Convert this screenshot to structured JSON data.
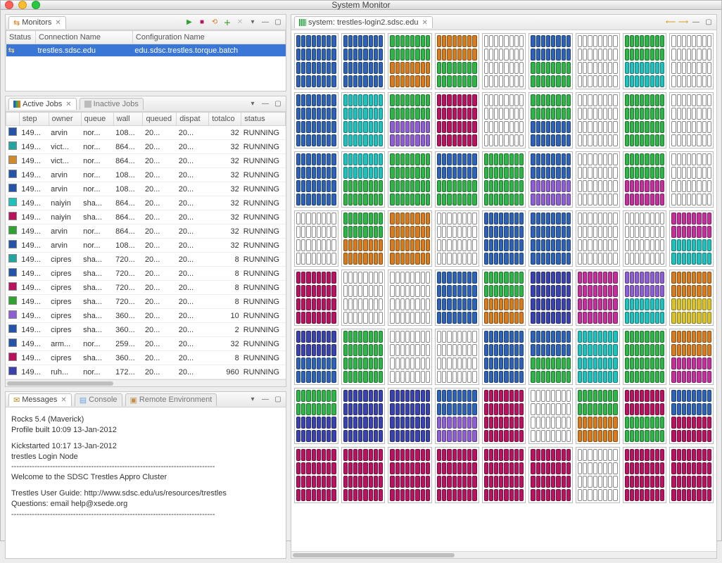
{
  "window": {
    "title": "System Monitor"
  },
  "toolbar_icons": {
    "play": "▶",
    "stop": "■",
    "refresh": "⟲",
    "add": "＋",
    "remove": "✕",
    "menu": "▾",
    "min": "—",
    "max": "▢",
    "left": "⟵",
    "right": "⟶"
  },
  "monitors": {
    "tab_label": "Monitors",
    "columns": [
      "Status",
      "Connection Name",
      "Configuration Name"
    ],
    "row": {
      "status": "",
      "connection": "trestles.sdsc.edu",
      "config": "edu.sdsc.trestles.torque.batch"
    }
  },
  "jobs": {
    "active_tab": "Active Jobs",
    "inactive_tab": "Inactive Jobs",
    "columns": [
      "",
      "step",
      "owner",
      "queue",
      "wall",
      "queued",
      "dispat",
      "totalco",
      "status"
    ],
    "rows": [
      {
        "c": "#2255aa",
        "step": "149...",
        "owner": "arvin",
        "queue": "nor...",
        "wall": "108...",
        "queued": "20...",
        "dispat": "20...",
        "total": "32",
        "status": "RUNNING"
      },
      {
        "c": "#1fa6a0",
        "step": "149...",
        "owner": "vict...",
        "queue": "nor...",
        "wall": "864...",
        "queued": "20...",
        "dispat": "20...",
        "total": "32",
        "status": "RUNNING"
      },
      {
        "c": "#d08a2a",
        "step": "149...",
        "owner": "vict...",
        "queue": "nor...",
        "wall": "864...",
        "queued": "20...",
        "dispat": "20...",
        "total": "32",
        "status": "RUNNING"
      },
      {
        "c": "#2255aa",
        "step": "149...",
        "owner": "arvin",
        "queue": "nor...",
        "wall": "108...",
        "queued": "20...",
        "dispat": "20...",
        "total": "32",
        "status": "RUNNING"
      },
      {
        "c": "#2255aa",
        "step": "149...",
        "owner": "arvin",
        "queue": "nor...",
        "wall": "108...",
        "queued": "20...",
        "dispat": "20...",
        "total": "32",
        "status": "RUNNING"
      },
      {
        "c": "#1fc1bd",
        "step": "149...",
        "owner": "naiyin",
        "queue": "sha...",
        "wall": "864...",
        "queued": "20...",
        "dispat": "20...",
        "total": "32",
        "status": "RUNNING"
      },
      {
        "c": "#b9135f",
        "step": "149...",
        "owner": "naiyin",
        "queue": "sha...",
        "wall": "864...",
        "queued": "20...",
        "dispat": "20...",
        "total": "32",
        "status": "RUNNING"
      },
      {
        "c": "#2fa22f",
        "step": "149...",
        "owner": "arvin",
        "queue": "nor...",
        "wall": "864...",
        "queued": "20...",
        "dispat": "20...",
        "total": "32",
        "status": "RUNNING"
      },
      {
        "c": "#2255aa",
        "step": "149...",
        "owner": "arvin",
        "queue": "nor...",
        "wall": "108...",
        "queued": "20...",
        "dispat": "20...",
        "total": "32",
        "status": "RUNNING"
      },
      {
        "c": "#1fa6a0",
        "step": "149...",
        "owner": "cipres",
        "queue": "sha...",
        "wall": "720...",
        "queued": "20...",
        "dispat": "20...",
        "total": "8",
        "status": "RUNNING"
      },
      {
        "c": "#2255aa",
        "step": "149...",
        "owner": "cipres",
        "queue": "sha...",
        "wall": "720...",
        "queued": "20...",
        "dispat": "20...",
        "total": "8",
        "status": "RUNNING"
      },
      {
        "c": "#b9135f",
        "step": "149...",
        "owner": "cipres",
        "queue": "sha...",
        "wall": "720...",
        "queued": "20...",
        "dispat": "20...",
        "total": "8",
        "status": "RUNNING"
      },
      {
        "c": "#2fa22f",
        "step": "149...",
        "owner": "cipres",
        "queue": "sha...",
        "wall": "720...",
        "queued": "20...",
        "dispat": "20...",
        "total": "8",
        "status": "RUNNING"
      },
      {
        "c": "#8e5fd4",
        "step": "149...",
        "owner": "cipres",
        "queue": "sha...",
        "wall": "360...",
        "queued": "20...",
        "dispat": "20...",
        "total": "10",
        "status": "RUNNING"
      },
      {
        "c": "#2255aa",
        "step": "149...",
        "owner": "cipres",
        "queue": "sha...",
        "wall": "360...",
        "queued": "20...",
        "dispat": "20...",
        "total": "2",
        "status": "RUNNING"
      },
      {
        "c": "#2255aa",
        "step": "149...",
        "owner": "arm...",
        "queue": "nor...",
        "wall": "259...",
        "queued": "20...",
        "dispat": "20...",
        "total": "32",
        "status": "RUNNING"
      },
      {
        "c": "#b9135f",
        "step": "149...",
        "owner": "cipres",
        "queue": "sha...",
        "wall": "360...",
        "queued": "20...",
        "dispat": "20...",
        "total": "8",
        "status": "RUNNING"
      },
      {
        "c": "#3a42b0",
        "step": "149...",
        "owner": "ruh...",
        "queue": "nor...",
        "wall": "172...",
        "queued": "20...",
        "dispat": "20...",
        "total": "960",
        "status": "RUNNING"
      }
    ]
  },
  "messages": {
    "tab_messages": "Messages",
    "tab_console": "Console",
    "tab_remote": "Remote Environment",
    "lines": {
      "l1": "Rocks 5.4 (Maverick)",
      "l2": "Profile built 10:09 13-Jan-2012",
      "l3": "Kickstarted 10:17 13-Jan-2012",
      "l4": "trestles Login Node",
      "dash": "-------------------------------------------------------------------------------",
      "l5": "Welcome to the SDSC Trestles Appro Cluster",
      "l6": "Trestles User Guide: http://www.sdsc.edu/us/resources/trestles",
      "l7": "Questions: email help@xsede.org"
    }
  },
  "system": {
    "tab_label": "system: trestles-login2.sdsc.edu",
    "palette": {
      "blue": "#2e62b8",
      "green": "#2fb447",
      "orange": "#d87a1e",
      "teal": "#1fc1bd",
      "purple": "#8e5fd4",
      "pink": "#c42f9c",
      "crimson": "#b9135f",
      "navy": "#3a42b0",
      "yellow": "#d9c12a",
      "white": "#ffffff"
    },
    "grid": [
      [
        "blue",
        "blue",
        "green/orange",
        "orange/green",
        "white",
        "blue/green",
        "white",
        "green/teal",
        "white"
      ],
      [
        "blue",
        "teal",
        "green/purple",
        "crimson",
        "white",
        "green/blue",
        "white",
        "green",
        "white"
      ],
      [
        "blue",
        "teal/green",
        "green",
        "blue/green",
        "green",
        "blue/purple",
        "white",
        "green/pink",
        "white"
      ],
      [
        "white",
        "green/orange",
        "orange",
        "white",
        "blue",
        "blue",
        "white",
        "white",
        "pink/teal"
      ],
      [
        "crimson",
        "white",
        "white",
        "blue",
        "green/orange",
        "navy",
        "pink",
        "purple/teal",
        "orange/yellow"
      ],
      [
        "navy/blue",
        "green",
        "white",
        "white",
        "blue",
        "blue/green",
        "teal",
        "green",
        "orange/pink"
      ],
      [
        "green/navy",
        "navy",
        "navy",
        "blue/purple",
        "crimson",
        "white",
        "green/orange",
        "crimson/green",
        "blue/crimson"
      ],
      [
        "crimson",
        "crimson",
        "crimson",
        "crimson",
        "crimson",
        "crimson",
        "white",
        "crimson",
        "crimson"
      ]
    ]
  }
}
